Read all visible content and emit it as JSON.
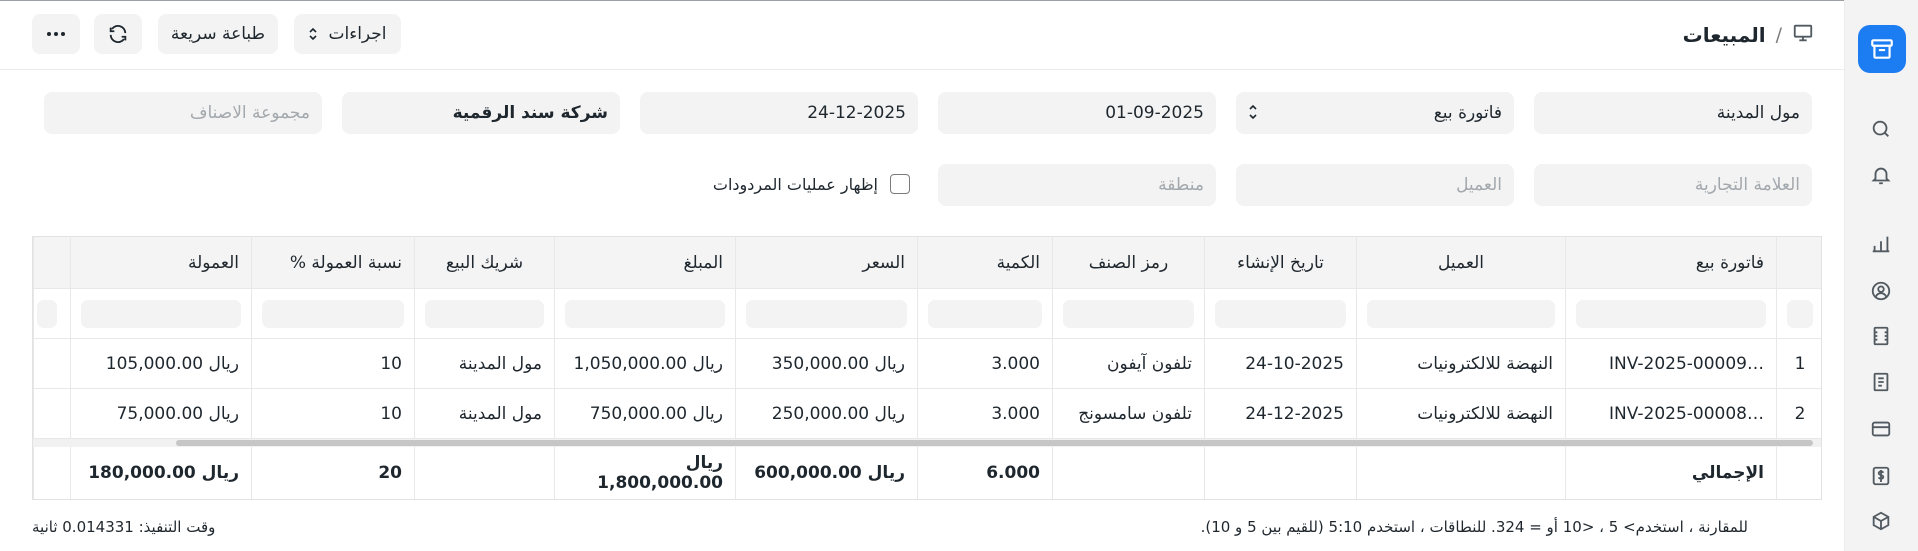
{
  "breadcrumb": {
    "separator": "/",
    "title": "المبيعات"
  },
  "toolbar": {
    "more_label": "···",
    "quick_print_label": "طباعة سريعة",
    "actions_label": "اجراءات"
  },
  "filters": {
    "branch": {
      "value": "مول المدينة"
    },
    "doc_type": {
      "value": "فاتورة بيع"
    },
    "from_date": {
      "value": "01-09-2025"
    },
    "to_date": {
      "value": "24-12-2025"
    },
    "company": {
      "value": "شركة سند الرقمية"
    },
    "item_group": {
      "placeholder": "مجموعة الاصناف"
    },
    "brand": {
      "placeholder": "العلامة التجارية"
    },
    "customer": {
      "placeholder": "العميل"
    },
    "territory": {
      "placeholder": "منطقة"
    },
    "show_returns_label": "إظهار عمليات المردودات"
  },
  "table": {
    "columns": [
      "فاتورة بيع",
      "العميل",
      "تاريخ الإنشاء",
      "رمز الصنف",
      "الكمية",
      "السعر",
      "المبلغ",
      "شريك البيع",
      "نسبة العمولة %",
      "العمولة"
    ],
    "rows": [
      {
        "idx": "1",
        "invoice": "INV-2025-00009…",
        "customer": "النهضة للالكترونيات",
        "date": "24-10-2025",
        "item": "تلفون آيفون",
        "qty": "3.000",
        "rate": "ريال 350,000.00",
        "amount": "ريال 1,050,000.00",
        "partner": "مول المدينة",
        "commission_rate": "10",
        "commission": "ريال 105,000.00"
      },
      {
        "idx": "2",
        "invoice": "INV-2025-00008…",
        "customer": "النهضة للالكترونيات",
        "date": "24-12-2025",
        "item": "تلفون سامسونج",
        "qty": "3.000",
        "rate": "ريال 250,000.00",
        "amount": "ريال 750,000.00",
        "partner": "مول المدينة",
        "commission_rate": "10",
        "commission": "ريال 75,000.00"
      }
    ],
    "totals": {
      "label": "الإجمالي",
      "qty": "6.000",
      "rate": "ريال 600,000.00",
      "amount": "ريال 1,800,000.00",
      "commission_rate": "20",
      "commission": "ريال 180,000.00"
    }
  },
  "footer": {
    "hint": "للمقارنة ، استخدم> 5 ، <10 أو = 324. للنطاقات ، استخدم 5:10 (للقيم بين 5 و 10).",
    "exec_time": "وقت التنفيذ: 0.014331 ثانية"
  },
  "colors": {
    "accent": "#1c7cf2",
    "field_bg": "#f3f3f3"
  }
}
